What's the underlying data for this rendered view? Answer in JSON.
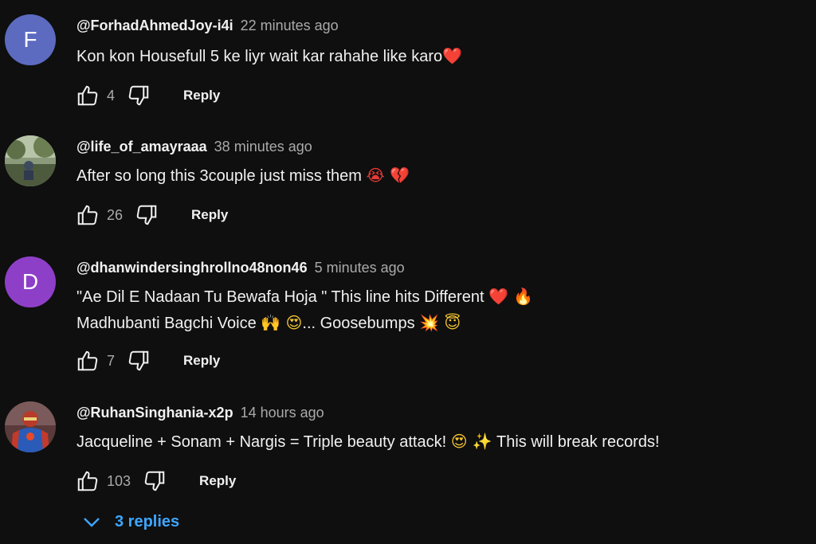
{
  "comments": [
    {
      "avatar_letter": "F",
      "avatar_color": "#5c6bc0",
      "author": "@ForhadAhmedJoy-i4i",
      "time": "22 minutes ago",
      "lines": [
        [
          "Kon kon Housefull 5 ke liyr wait kar rahahe like karo",
          "❤️"
        ]
      ],
      "likes": "4",
      "reply_label": "Reply"
    },
    {
      "avatar_icon": "photo-avatar",
      "author": "@life_of_amayraaa",
      "time": "38 minutes ago",
      "lines": [
        [
          "After so long this 3couple just miss them ",
          "😭 💔"
        ]
      ],
      "likes": "26",
      "reply_label": "Reply"
    },
    {
      "avatar_letter": "D",
      "avatar_color": "#8e3fc8",
      "author": "@dhanwindersinghrollno48non46",
      "time": "5 minutes ago",
      "lines": [
        [
          "\"Ae Dil E Nadaan Tu Bewafa Hoja \" This line hits Different ",
          "❤️ 🔥"
        ],
        [
          "Madhubanti Bagchi Voice ",
          "🙌 😍",
          "... Goosebumps ",
          "💥 😇"
        ]
      ],
      "likes": "7",
      "reply_label": "Reply"
    },
    {
      "avatar_icon": "superhero-avatar",
      "author": "@RuhanSinghania-x2p",
      "time": "14 hours ago",
      "lines": [
        [
          "Jacqueline + Sonam + Nargis = Triple beauty attack! ",
          "😍 ✨",
          " This will break records!"
        ]
      ],
      "likes": "103",
      "reply_label": "Reply"
    }
  ],
  "replies_toggle": "3 replies",
  "colors": {
    "background": "#0f0f0f",
    "text": "#f1f1f1",
    "muted": "#aaaaaa",
    "link": "#3ea6ff"
  },
  "icons": [
    "thumb-up-icon",
    "thumb-down-icon",
    "chevron-down-icon"
  ]
}
